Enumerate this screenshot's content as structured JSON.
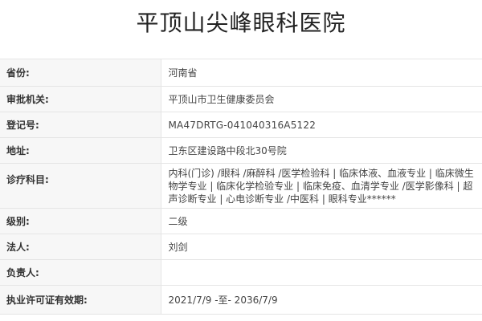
{
  "page": {
    "title": "平顶山尖峰眼科医院"
  },
  "info": {
    "rows": [
      {
        "label": "省份:",
        "value": "河南省"
      },
      {
        "label": "审批机关:",
        "value": "平顶山市卫生健康委员会"
      },
      {
        "label": "登记号:",
        "value": "MA47DRTG-041040316A5122"
      },
      {
        "label": "地址:",
        "value": "卫东区建设路中段北30号院"
      },
      {
        "label": "诊疗科目:",
        "value": "内科(门诊) /眼科 /麻醉科 /医学检验科 | 临床体液、血液专业 | 临床微生物学专业 | 临床化学检验专业 | 临床免疫、血清学专业 /医学影像科 | 超声诊断专业 | 心电诊断专业 /中医科 | 眼科专业******"
      },
      {
        "label": "级别:",
        "value": "二级"
      },
      {
        "label": "法人:",
        "value": "刘剑"
      },
      {
        "label": "负责人:",
        "value": ""
      },
      {
        "label": "执业许可证有效期:",
        "value": "2021/7/9 -至- 2036/7/9"
      }
    ]
  }
}
